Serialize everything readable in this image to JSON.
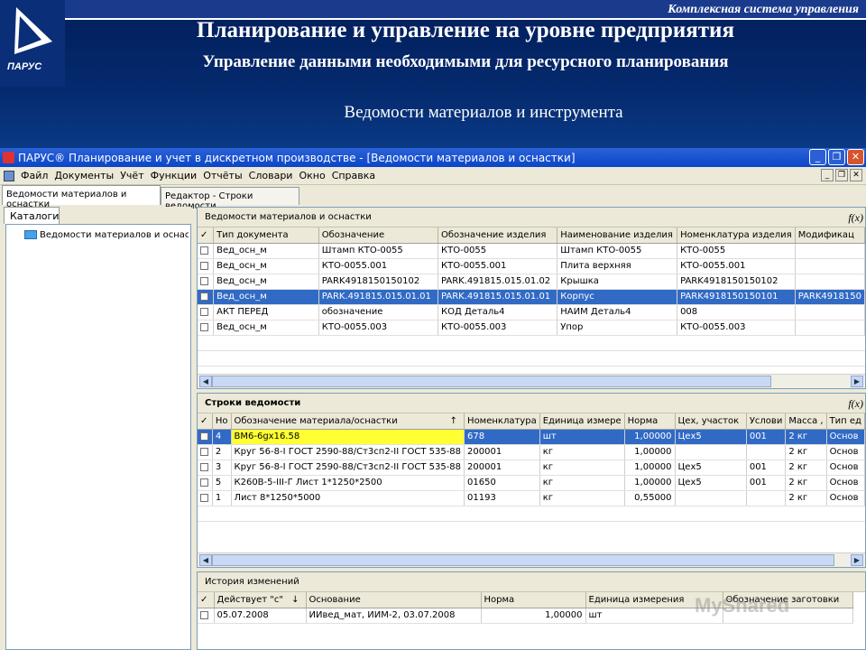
{
  "slide": {
    "top_bar": "Комплексная система управления",
    "logo_text": "ПАРУС",
    "title": "Планирование и управление на уровне предприятия",
    "subtitle": "Управление данными необходимыми для ресурсного планирования",
    "section": "Ведомости материалов и инструмента"
  },
  "window": {
    "title": "ПАРУС® Планирование и учет в дискретном производстве - [Ведомости материалов и оснастки]",
    "buttons": [
      "_",
      "❐",
      "✕"
    ]
  },
  "menu": [
    "Файл",
    "Документы",
    "Учёт",
    "Функции",
    "Отчёты",
    "Словари",
    "Окно",
    "Справка"
  ],
  "tabs": [
    "Ведомости материалов и оснастки",
    "Редактор - Строки ведомости"
  ],
  "catalog": {
    "tab": "Каталоги",
    "tree_item": "Ведомости материалов и оснастки"
  },
  "panel1": {
    "title": "Ведомости материалов и оснастки",
    "fx": "f(x)",
    "columns": [
      "Тип документа",
      "Обозначение",
      "Обозначение изделия",
      "Наименование изделия",
      "Номенклатура изделия",
      "Модификац"
    ],
    "rows": [
      [
        "Вед_осн_м",
        "Штамп КТО-0055",
        "КТО-0055",
        "Штамп КТО-0055",
        "КТО-0055",
        ""
      ],
      [
        "Вед_осн_м",
        "КТО-0055.001",
        "КТО-0055.001",
        "Плита верхняя",
        "КТО-0055.001",
        ""
      ],
      [
        "Вед_осн_м",
        "PARK4918150150102",
        "PARK.491815.015.01.02",
        "Крышка",
        "PARK4918150150102",
        ""
      ],
      [
        "Вед_осн_м",
        "PARK.491815.015.01.01",
        "PARK.491815.015.01.01",
        "Корпус",
        "PARK4918150150101",
        "PARK4918150"
      ],
      [
        "АКТ ПЕРЕД",
        "обозначение",
        "КОД Деталь4",
        "НАИМ Деталь4",
        "008",
        ""
      ],
      [
        "Вед_осн_м",
        "КТО-0055.003",
        "КТО-0055.003",
        "Упор",
        "КТО-0055.003",
        ""
      ]
    ],
    "selected_row": 3
  },
  "panel2": {
    "title": "Строки ведомости",
    "fx": "f(x)",
    "columns": [
      "Но",
      "Обозначение материала/оснастки",
      "Номенклатура",
      "Единица измере",
      "Норма",
      "Цех, участок",
      "Услови",
      "Масса ,",
      "Тип ед"
    ],
    "sort_icon": "↑",
    "rows": [
      [
        "4",
        "ВМ6-6gx16.58",
        "678",
        "шт",
        "1,00000",
        "Цех5",
        "001",
        "2 кг",
        "Основ"
      ],
      [
        "2",
        "Круг 56-8-I ГОСТ 2590-88/Ст3сп2-II ГОСТ 535-88",
        "200001",
        "кг",
        "1,00000",
        "",
        "",
        "2 кг",
        "Основ"
      ],
      [
        "3",
        "Круг 56-8-I ГОСТ 2590-88/Ст3сп2-II ГОСТ 535-88",
        "200001",
        "кг",
        "1,00000",
        "Цех5",
        "001",
        "2 кг",
        "Основ"
      ],
      [
        "5",
        "К260В-5-III-Г Лист  1*1250*2500",
        "01650",
        "кг",
        "1,00000",
        "Цех5",
        "001",
        "2 кг",
        "Основ"
      ],
      [
        "1",
        "Лист  8*1250*5000",
        "01193",
        "кг",
        "0,55000",
        "",
        "",
        "2 кг",
        "Основ"
      ]
    ],
    "selected_row": 0
  },
  "panel3": {
    "title": "История изменений",
    "columns": [
      "Действует \"с\"",
      "Основание",
      "Норма",
      "Единица измерения",
      "Обозначение заготовки"
    ],
    "sort_icon": "↓",
    "rows": [
      [
        "05.07.2008",
        "ИИвед_мат, ИИМ-2, 03.07.2008",
        "1,00000",
        "шт",
        ""
      ]
    ]
  },
  "watermark": "MyShared"
}
